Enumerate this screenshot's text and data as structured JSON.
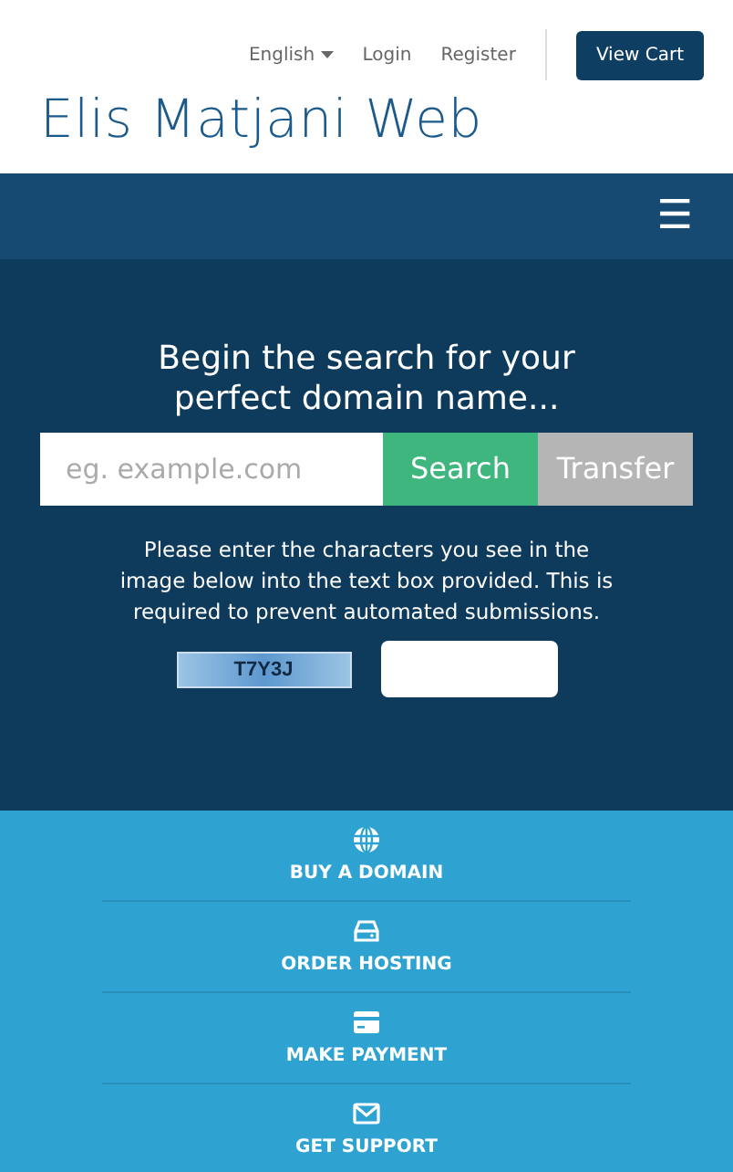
{
  "top_links": [
    {
      "label": "English",
      "dropdown": true
    },
    {
      "label": "Login",
      "dropdown": false
    },
    {
      "label": "Register",
      "dropdown": false
    }
  ],
  "cart_button": "View Cart",
  "site_title": "Elis Matjani Web",
  "menu_toggle": "☰",
  "hero": {
    "heading": "Begin the search for your perfect domain name...",
    "search": {
      "placeholder": "eg. example.com"
    },
    "buttons": [
      {
        "label": "Search",
        "kind": "search"
      },
      {
        "label": "Transfer",
        "kind": "transfer"
      }
    ],
    "captcha_note": "Please enter the characters you see in the image below into the text box provided. This is required to prevent automated submissions.",
    "captcha_code": "T7Y3J"
  },
  "shortcuts": [
    {
      "label": "BUY A DOMAIN",
      "kind": "globe"
    },
    {
      "label": "ORDER HOSTING",
      "kind": "server"
    },
    {
      "label": "MAKE PAYMENT",
      "kind": "card"
    },
    {
      "label": "GET SUPPORT",
      "kind": "envelope"
    }
  ]
}
